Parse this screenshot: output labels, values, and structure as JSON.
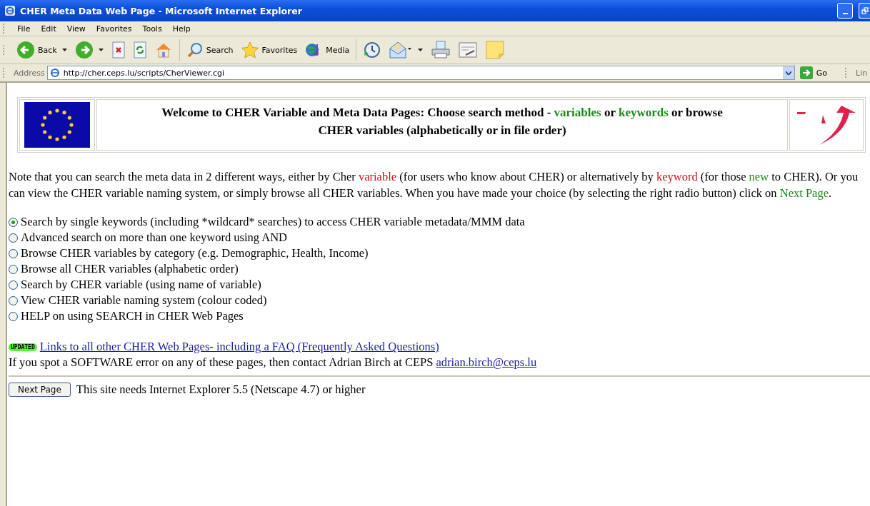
{
  "window": {
    "title": "CHER Meta Data Web Page - Microsoft Internet Explorer"
  },
  "menu": [
    "File",
    "Edit",
    "View",
    "Favorites",
    "Tools",
    "Help"
  ],
  "toolbar": [
    {
      "kind": "back",
      "label": "Back"
    },
    {
      "kind": "forward"
    },
    {
      "kind": "stop"
    },
    {
      "kind": "refresh"
    },
    {
      "kind": "home"
    },
    {
      "kind": "search",
      "label": "Search"
    },
    {
      "kind": "favorites",
      "label": "Favorites"
    },
    {
      "kind": "media",
      "label": "Media"
    },
    {
      "kind": "history"
    },
    {
      "kind": "mail"
    },
    {
      "kind": "print"
    },
    {
      "kind": "edit"
    },
    {
      "kind": "note"
    }
  ],
  "address": {
    "label": "Address",
    "value": "http://cher.ceps.lu/scripts/CherViewer.cgi",
    "go": "Go",
    "links": "Lin"
  },
  "header": {
    "segments": [
      {
        "text": "Welcome to CHER Variable and Meta Data Pages: Choose search method - "
      },
      {
        "text": "variables",
        "color": "#1a8a1a"
      },
      {
        "text": " or "
      },
      {
        "text": "keywords",
        "color": "#1a8a1a"
      },
      {
        "text": " or browse CHER variables (alphabetically or in file order)"
      }
    ]
  },
  "intro": [
    {
      "text": "Note that you can search the meta data in 2 different ways, either by Cher "
    },
    {
      "text": "variable",
      "color": "#cc1111"
    },
    {
      "text": " (for users who know about CHER) or alternatively by "
    },
    {
      "text": "keyword",
      "color": "#cc1111"
    },
    {
      "text": " (for those "
    },
    {
      "text": "new",
      "color": "#1a8a1a"
    },
    {
      "text": " to CHER). Or you can view the CHER variable naming system, or simply browse all CHER variables. When you have made your choice (by selecting the right radio button) click on "
    },
    {
      "text": "Next Page",
      "color": "#1a8a1a"
    },
    {
      "text": "."
    }
  ],
  "options": [
    {
      "label": "Search by single keywords (including *wildcard* searches) to access CHER variable metadata/MMM data",
      "selected": true
    },
    {
      "label": "Advanced search on more than one keyword using AND",
      "selected": false
    },
    {
      "label": "Browse CHER variables by category (e.g. Demographic, Health, Income)",
      "selected": false
    },
    {
      "label": "Browse all CHER variables (alphabetic order)",
      "selected": false
    },
    {
      "label": "Search by CHER variable (using name of variable)",
      "selected": false
    },
    {
      "label": "View CHER variable naming system (colour coded)",
      "selected": false
    },
    {
      "label": "HELP on using SEARCH in CHER Web Pages",
      "selected": false
    }
  ],
  "updated_badge": "UPDATED",
  "links_link": "Links to all other CHER Web Pages- including a FAQ (Frequently Asked Questions)",
  "contact": {
    "text": "If you spot a SOFTWARE error on any of these pages, then contact Adrian Birch at CEPS ",
    "email": "adrian.birch@ceps.lu"
  },
  "next_button": "Next Page",
  "requirement": "This site needs Internet Explorer 5.5 (Netscape 4.7) or higher"
}
